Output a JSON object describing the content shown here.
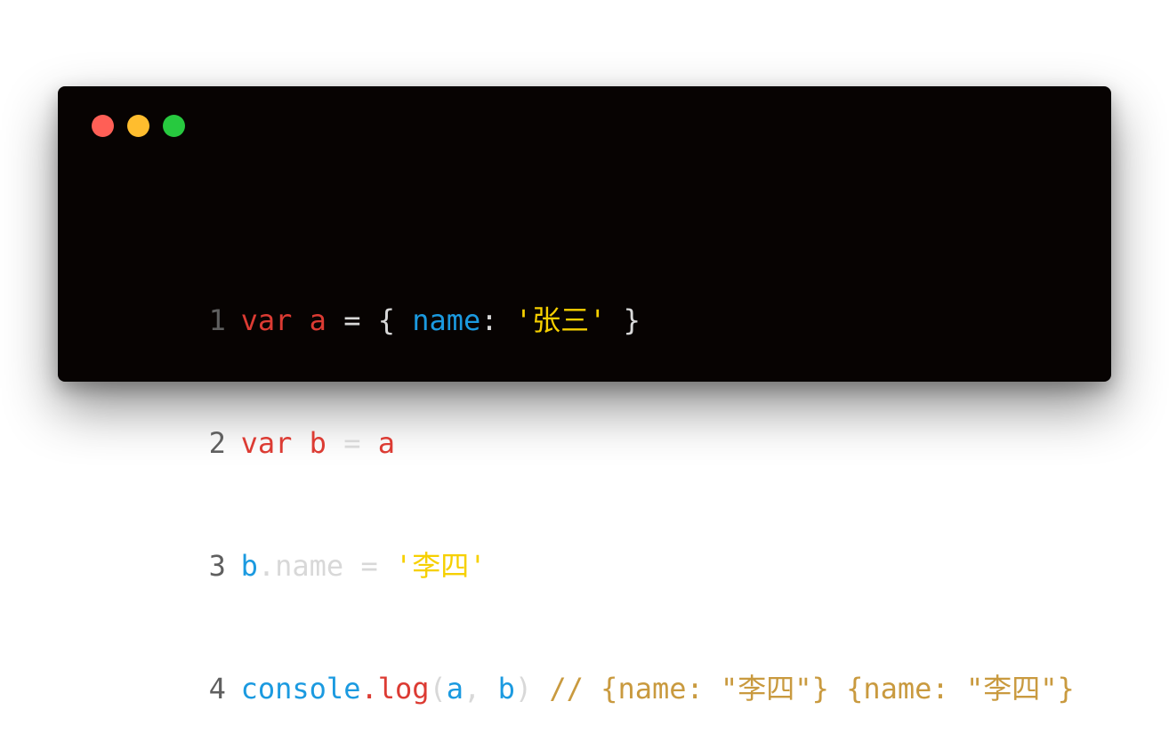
{
  "window": {
    "dot_colors": {
      "close": "#ff5f56",
      "minimize": "#ffbd2e",
      "maximize": "#27c93f"
    }
  },
  "code": {
    "lines": [
      {
        "number": "1",
        "tokens": [
          {
            "text": "var",
            "kind": "keyword"
          },
          {
            "text": " ",
            "kind": "plain"
          },
          {
            "text": "a",
            "kind": "keyword"
          },
          {
            "text": " = { ",
            "kind": "plain"
          },
          {
            "text": "name",
            "kind": "property"
          },
          {
            "text": ": ",
            "kind": "plain"
          },
          {
            "text": "'张三'",
            "kind": "string"
          },
          {
            "text": " }",
            "kind": "plain"
          }
        ]
      },
      {
        "number": "2",
        "tokens": [
          {
            "text": "var",
            "kind": "keyword"
          },
          {
            "text": " ",
            "kind": "plain"
          },
          {
            "text": "b",
            "kind": "keyword"
          },
          {
            "text": " = ",
            "kind": "plain"
          },
          {
            "text": "a",
            "kind": "keyword"
          }
        ]
      },
      {
        "number": "3",
        "tokens": [
          {
            "text": "b",
            "kind": "property"
          },
          {
            "text": ".name = ",
            "kind": "plain"
          },
          {
            "text": "'李四'",
            "kind": "string"
          }
        ]
      },
      {
        "number": "4",
        "tokens": [
          {
            "text": "console",
            "kind": "property"
          },
          {
            "text": ".",
            "kind": "keyword"
          },
          {
            "text": "log",
            "kind": "keyword"
          },
          {
            "text": "(",
            "kind": "plain"
          },
          {
            "text": "a",
            "kind": "property"
          },
          {
            "text": ", ",
            "kind": "plain"
          },
          {
            "text": "b",
            "kind": "property"
          },
          {
            "text": ") ",
            "kind": "plain"
          },
          {
            "text": "// {name: \"李四\"} {name: \"李四\"}",
            "kind": "comment"
          }
        ]
      }
    ]
  }
}
